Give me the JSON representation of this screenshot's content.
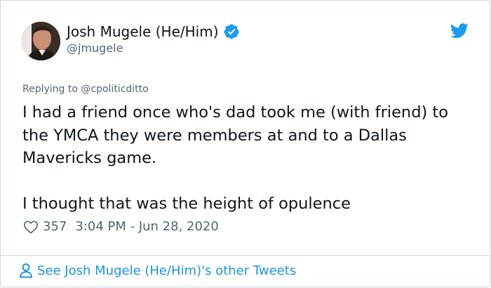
{
  "author": {
    "name": "Josh Mugele (He/Him)",
    "handle": "@jmugele",
    "verified": true
  },
  "reply": {
    "prefix": "Replying to ",
    "mention": "@cpoliticditto"
  },
  "tweet": {
    "paragraph1": "I had a friend once who's dad took me (with friend) to the YMCA they were members at and to a Dallas Mavericks game.",
    "paragraph2": "I thought that was the height of opulence"
  },
  "stats": {
    "likes": "357",
    "timestamp": "3:04 PM - Jun 28, 2020"
  },
  "footer": {
    "link_label": "See Josh Mugele (He/Him)'s other Tweets"
  },
  "colors": {
    "accent": "#1b95e0",
    "verified": "#1d9bf0",
    "secondary_text": "#536471",
    "primary_text": "#0f1419",
    "border": "#cfd9de"
  },
  "icons": {
    "verified": "verified-badge-icon",
    "bird": "twitter-bird-icon",
    "heart": "heart-outline-icon",
    "person": "person-outline-icon"
  }
}
